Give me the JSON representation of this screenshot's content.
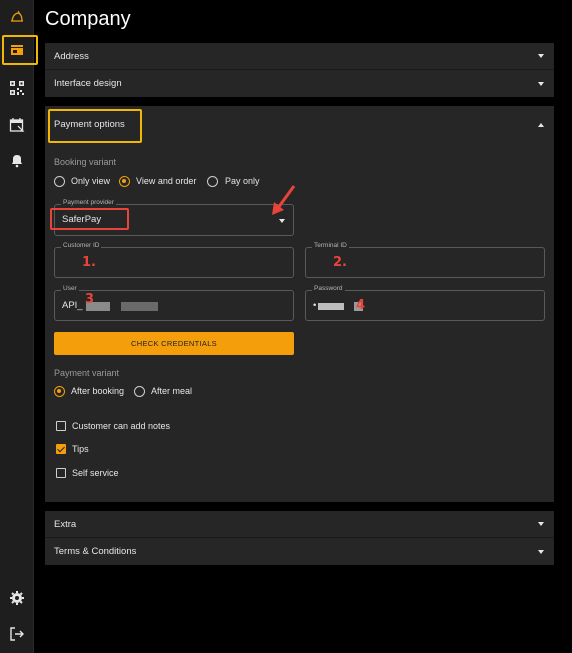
{
  "sidebar": {
    "items": [
      {
        "icon": "logo-icon"
      },
      {
        "icon": "store-icon"
      },
      {
        "icon": "qr-code-icon"
      },
      {
        "icon": "calendar-icon"
      },
      {
        "icon": "bell-icon"
      },
      {
        "icon": "gear-icon"
      },
      {
        "icon": "logout-icon"
      }
    ]
  },
  "page": {
    "title": "Company"
  },
  "sections": {
    "address": "Address",
    "interface_design": "Interface design",
    "payment_options": "Payment options",
    "extra": "Extra",
    "terms": "Terms & Conditions"
  },
  "booking": {
    "label": "Booking variant",
    "options": [
      "Only view",
      "View and order",
      "Pay only"
    ],
    "selected": "View and order"
  },
  "payment_provider": {
    "legend": "Payment provider",
    "value": "SaferPay"
  },
  "customer_id": {
    "legend": "Customer ID",
    "value": ""
  },
  "terminal_id": {
    "legend": "Terminal ID",
    "value": ""
  },
  "user": {
    "legend": "User",
    "value": "API_"
  },
  "password": {
    "legend": "Password",
    "value": "•"
  },
  "check_button": "CHECK CREDENTIALS",
  "payment_variant": {
    "label": "Payment variant",
    "options": [
      "After booking",
      "After meal"
    ],
    "selected": "After booking"
  },
  "checkboxes": [
    {
      "label": "Customer can add notes",
      "checked": false
    },
    {
      "label": "Tips",
      "checked": true
    },
    {
      "label": "Self service",
      "checked": false
    }
  ],
  "annotations": [
    "1.",
    "2.",
    "3",
    "4"
  ],
  "colors": {
    "accent": "#f59e0b",
    "highlight": "#f2b705",
    "annotation": "#e8443a"
  }
}
